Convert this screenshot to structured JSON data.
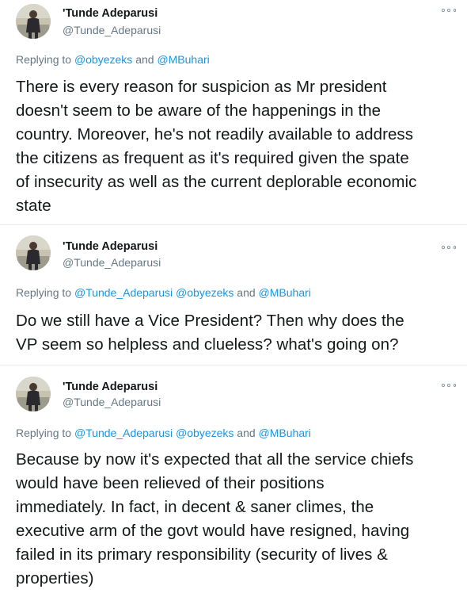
{
  "tweets": [
    {
      "author": {
        "name": "'Tunde Adeparusi",
        "handle": "@Tunde_Adeparusi"
      },
      "replying": {
        "prefix": "Replying to",
        "mentions": [
          "@obyezeks",
          "@MBuhari"
        ],
        "joiner": "and"
      },
      "text_lines": [
        "There is every reason for suspicion as Mr president",
        "doesn't seem to be aware of the happenings in the",
        "country. Moreover,  he's not readily available to address",
        "the citizens as frequent as it's required given the spate",
        "of insecurity as well as the current deplorable economic",
        "state"
      ]
    },
    {
      "author": {
        "name": "'Tunde Adeparusi",
        "handle": "@Tunde_Adeparusi"
      },
      "replying": {
        "prefix": "Replying to",
        "mentions": [
          "@Tunde_Adeparusi",
          "@obyezeks",
          "@MBuhari"
        ],
        "joiner": "and"
      },
      "text_lines": [
        "Do we still have a Vice President? Then why does the",
        "VP seem so helpless and clueless?  what's going on?"
      ]
    },
    {
      "author": {
        "name": "'Tunde Adeparusi",
        "handle": "@Tunde_Adeparusi"
      },
      "replying": {
        "prefix": "Replying to",
        "mentions": [
          "@Tunde_Adeparusi",
          "@obyezeks",
          "@MBuhari"
        ],
        "joiner": "and"
      },
      "text_lines": [
        "Because by now it's expected that all the service chiefs",
        "would have been relieved of their positions",
        "immediately. In fact, in decent & saner climes, the",
        "executive arm of the govt would have resigned, having",
        "failed in its primary responsibility (security of lives &",
        "properties)"
      ]
    }
  ],
  "icons": {
    "avatar": "profile-photo",
    "more": "more-options-icon"
  },
  "colors": {
    "name": "#14171a",
    "secondary_text": "#657786",
    "link": "#1b95e0",
    "divider": "#e6ecf0"
  }
}
